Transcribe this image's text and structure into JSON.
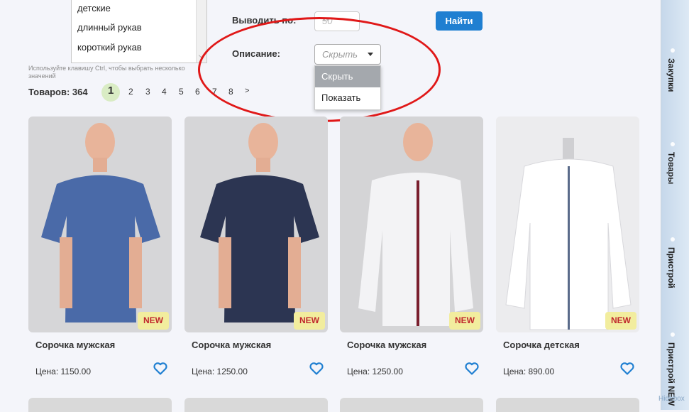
{
  "filters": {
    "listbox_items": [
      "детские",
      "длинный рукав",
      "короткий рукав"
    ],
    "hint_line1": "Используйте клавишу Ctrl, чтобы выбрать несколько",
    "hint_line2": "значений",
    "per_page_label": "Выводить по:",
    "per_page_value": "50",
    "description_label": "Описание:",
    "description_value": "Скрыть",
    "description_options": [
      "Скрыть",
      "Показать"
    ],
    "find_button": "Найти"
  },
  "pagination": {
    "count_label": "Товаров: 364",
    "pages": [
      "1",
      "2",
      "3",
      "4",
      "5",
      "6",
      "7",
      "8",
      ">"
    ],
    "current": "1"
  },
  "products": [
    {
      "name": "Сорочка мужская",
      "price": "Цена: 1150.00",
      "badge": "NEW",
      "shirt_color": "#4a6aa8"
    },
    {
      "name": "Сорочка мужская",
      "price": "Цена: 1250.00",
      "badge": "NEW",
      "shirt_color": "#2c3552"
    },
    {
      "name": "Сорочка мужская",
      "price": "Цена: 1250.00",
      "badge": "NEW",
      "shirt_color": "#f3f3f5"
    },
    {
      "name": "Сорочка детская",
      "price": "Цена: 890.00",
      "badge": "NEW",
      "shirt_color": "#ffffff"
    }
  ],
  "sidebar": {
    "tabs": [
      "Закупки",
      "Товары",
      "Пристрой",
      "Пристрой NEW"
    ],
    "footer": "Hidebox"
  },
  "colors": {
    "accent": "#1f7fd1",
    "annotation": "#e01818",
    "badge_bg": "#f2ed9e",
    "badge_text": "#c0282d"
  }
}
